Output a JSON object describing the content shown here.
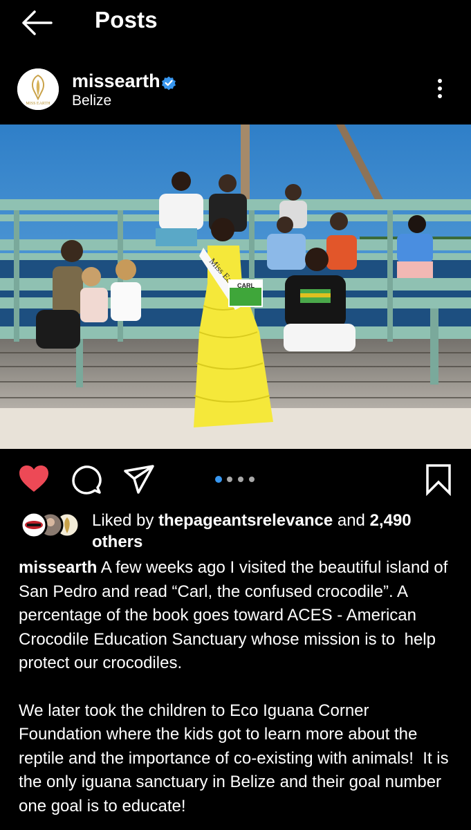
{
  "header": {
    "title": "Posts"
  },
  "post": {
    "username": "missearth",
    "location": "Belize",
    "logo_text": "MISS EARTH",
    "photo_texts": {
      "sash": "Miss Ea",
      "book": "CARL"
    },
    "carousel": {
      "total": 4,
      "active": 0
    },
    "likes": {
      "prefix": "Liked by ",
      "user": "thepageantsrelevance",
      "middle": " and ",
      "count": "2,490",
      "suffix": "others"
    },
    "caption": {
      "username": "missearth",
      "paragraph1": " A few weeks ago I visited the beautiful island of San Pedro and read “Carl, the confused crocodile”. A percentage of the book goes toward ACES - American Crocodile Education Sanctuary whose mission is to  help protect our crocodiles.",
      "paragraph2": "We later took the children to Eco Iguana Corner Foundation where the kids got to learn more about the reptile and the importance of co-existing with animals!  It is the only iguana sanctuary in Belize and their goal number one goal is to educate!"
    }
  },
  "colors": {
    "background": "#000000",
    "like_red": "#ed4956",
    "verified_blue": "#3897f0",
    "active_dot": "#3897f0",
    "inactive_dot": "#a8a8a8"
  },
  "icons": [
    "back-arrow-icon",
    "verified-badge-icon",
    "more-vertical-icon",
    "heart-icon",
    "comment-icon",
    "share-icon",
    "bookmark-icon"
  ]
}
